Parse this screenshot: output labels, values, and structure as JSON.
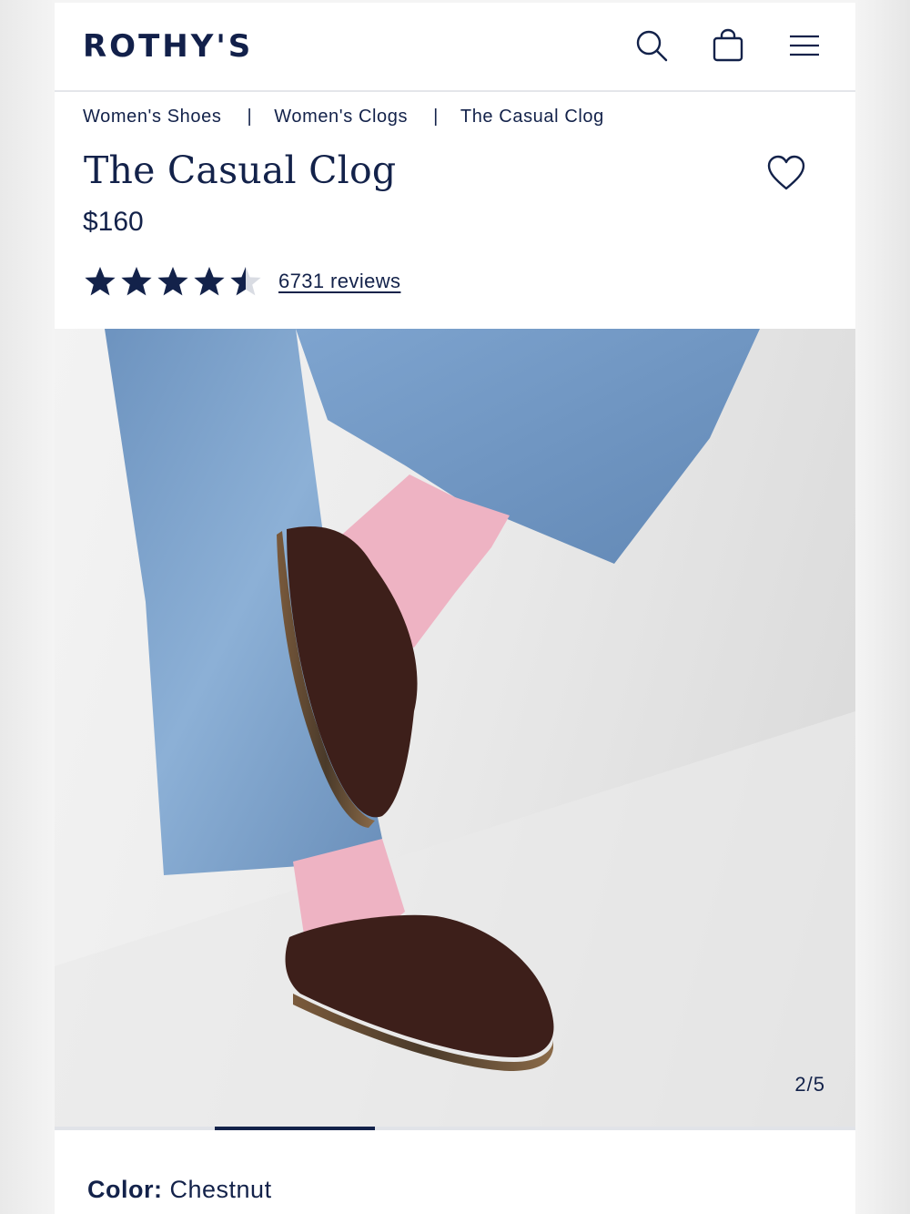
{
  "header": {
    "logo": "ROTHY'S",
    "icons": [
      "search-icon",
      "bag-icon",
      "menu-icon"
    ]
  },
  "breadcrumb": {
    "items": [
      "Women's Shoes",
      "Women's Clogs",
      "The Casual Clog"
    ],
    "separator": "|"
  },
  "product": {
    "title": "The Casual Clog",
    "price": "$160",
    "rating": 4.5,
    "reviews_label": "6731 reviews",
    "favorite_icon": "heart-outline-icon"
  },
  "gallery": {
    "counter": "2/5",
    "current_index": 2,
    "total": 5
  },
  "options": {
    "color_label": "Color:",
    "color_value": "Chestnut"
  },
  "colors": {
    "brand_navy": "#13224a",
    "sock": "#eeb3c3",
    "clog": "#3d1f1a",
    "denim": "#7fa4cc"
  }
}
